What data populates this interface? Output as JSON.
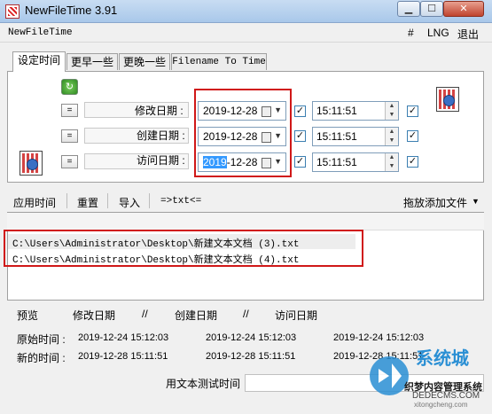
{
  "window": {
    "title": "NewFileTime 3.91"
  },
  "menu": {
    "app": "NewFileTime",
    "hash": "#",
    "lng": "LNG",
    "exit": "退出"
  },
  "tabs": [
    "设定时间",
    "更早一些",
    "更晚一些",
    "Filename To Time"
  ],
  "rows": [
    {
      "label": "修改日期 :",
      "date_prefix": "",
      "date": "2019-12-28",
      "time": "15:11:51"
    },
    {
      "label": "创建日期 :",
      "date_prefix": "",
      "date": "2019-12-28",
      "time": "15:11:51"
    },
    {
      "label": "访问日期 :",
      "date_prefix": "2019",
      "date": "-12-28",
      "time": "15:11:51"
    }
  ],
  "equal_btn": "=",
  "check": "✓",
  "toolbar": {
    "apply": "应用时间",
    "reset": "重置",
    "import": "导入",
    "txt": "=>txt<=",
    "drag": "拖放添加文件",
    "drag_arrow": "▼"
  },
  "files": [
    "C:\\Users\\Administrator\\Desktop\\新建文本文档 (3).txt",
    "C:\\Users\\Administrator\\Desktop\\新建文本文档 (4).txt"
  ],
  "preview": {
    "headers": [
      "预览",
      "修改日期",
      "//",
      "创建日期",
      "//",
      "访问日期"
    ],
    "original_label": "原始时间 :",
    "new_label": "新的时间 :",
    "original": [
      "2019-12-24 15:12:03",
      "2019-12-24 15:12:03",
      "2019-12-24 15:12:03"
    ],
    "new": [
      "2019-12-28 15:11:51",
      "2019-12-28 15:11:51",
      "2019-12-28 15:11:51"
    ]
  },
  "test_label": "用文本测试时间",
  "watermark": {
    "line1": "系统城",
    "line2": "织梦内容管理系统",
    "line3": "DEDECMS.COM",
    "line4": "xitongcheng.com"
  },
  "colors": {
    "highlight": "#d01818",
    "selection": "#3399ff"
  }
}
